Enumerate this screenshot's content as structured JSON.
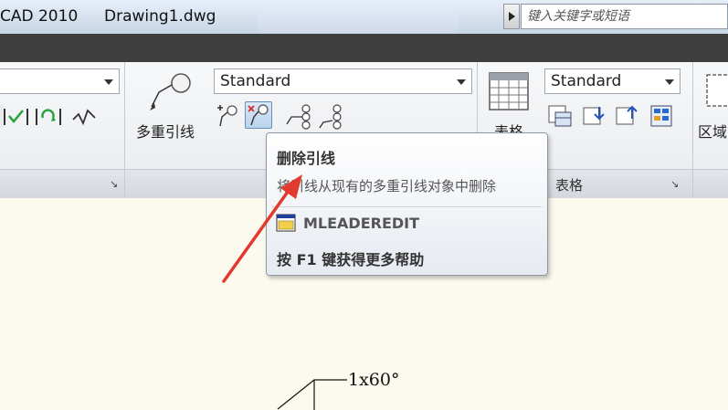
{
  "titlebar": {
    "app_title": "CAD 2010",
    "doc_title": "Drawing1.dwg",
    "search_placeholder": "键入关键字或短语"
  },
  "ribbon": {
    "left_panel_combo": "",
    "mleader_panel": {
      "big_button_label": "多重引线",
      "style_combo": "Standard"
    },
    "table_panel": {
      "big_button_label": "表格",
      "style_combo": "Standard",
      "panel_label": "表格"
    },
    "region_button_label": "区域"
  },
  "tooltip": {
    "title": "删除引线",
    "description": "将引线从现有的多重引线对象中删除",
    "command": "MLEADEREDIT",
    "help": "按 F1 键获得更多帮助"
  },
  "drawing": {
    "dimension_text": "1x60°"
  },
  "colors": {
    "annotation_arrow": "#e23a2e",
    "canvas": "#fcfaee",
    "dark_strip": "#3e3e3e"
  }
}
